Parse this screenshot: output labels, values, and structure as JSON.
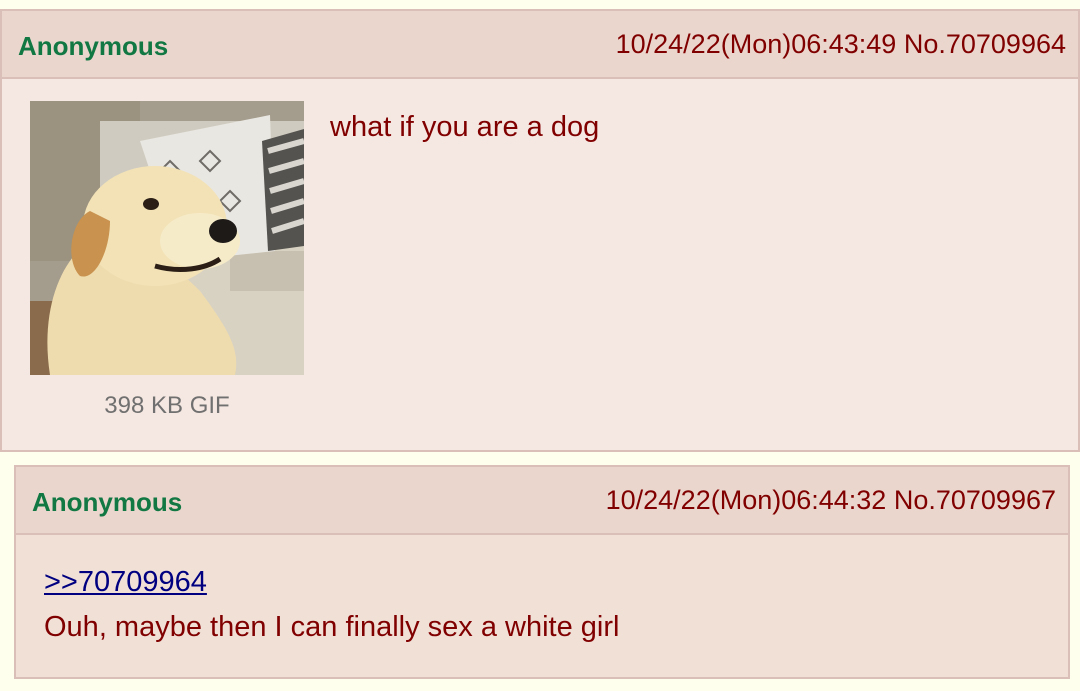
{
  "op": {
    "name": "Anonymous",
    "datetime": "10/24/22(Mon)06:43:49",
    "number": "No.70709964",
    "file_info": "398 KB GIF",
    "body": "what if you are a dog"
  },
  "reply": {
    "name": "Anonymous",
    "datetime": "10/24/22(Mon)06:44:32",
    "number": "No.70709967",
    "quote": ">>70709964",
    "body": "Ouh, maybe then I can finally sex a white girl"
  },
  "colors": {
    "page_bg": "#ffffee",
    "post_bg": "#f0e0d6",
    "name": "#117743",
    "text": "#800000",
    "link": "#000080"
  }
}
